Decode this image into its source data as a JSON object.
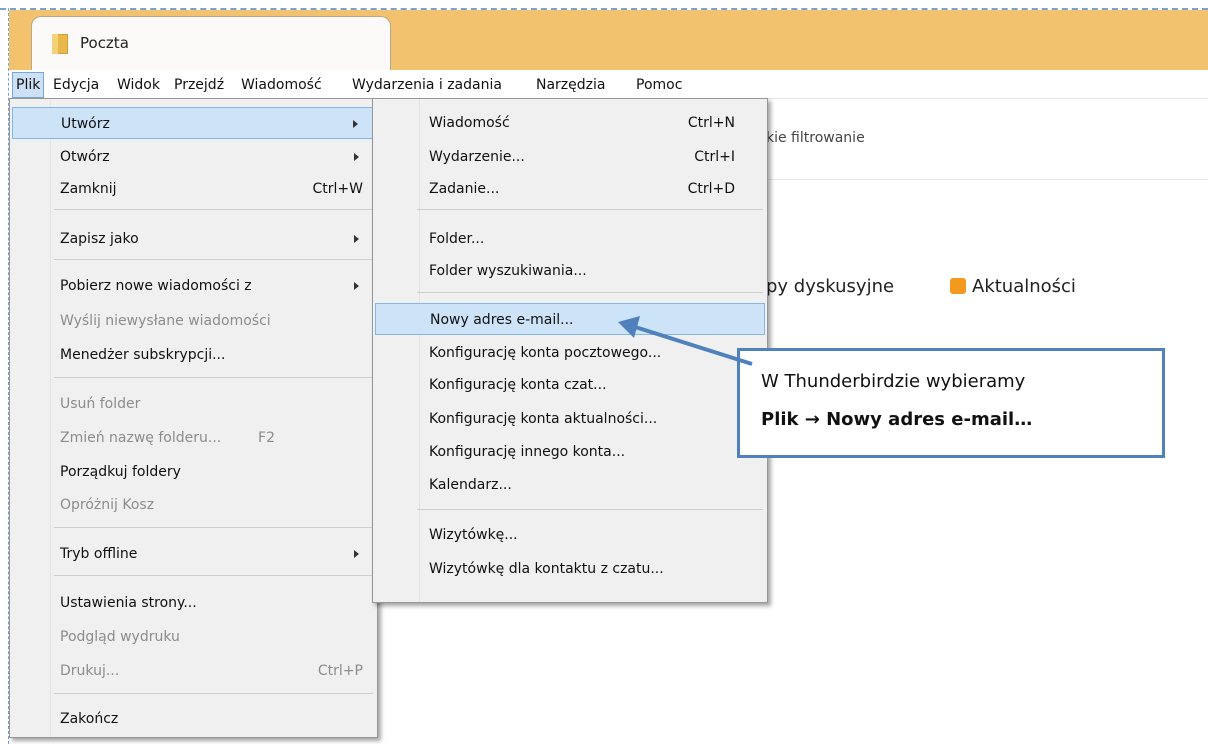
{
  "tab": {
    "label": "Poczta"
  },
  "menubar": {
    "items": [
      "Plik",
      "Edycja",
      "Widok",
      "Przejdź",
      "Wiadomość",
      "Wydarzenia i zadania",
      "Narzędzia",
      "Pomoc"
    ]
  },
  "background": {
    "filter_text": "kie filtrowanie",
    "groups_text": "py dyskusyjne",
    "feeds_text": "Aktualności"
  },
  "file_menu": {
    "items": [
      {
        "label": "Utwórz",
        "shortcut": ""
      },
      {
        "label": "Otwórz",
        "shortcut": ""
      },
      {
        "label": "Zamknij",
        "shortcut": "Ctrl+W"
      },
      {
        "label": "Zapisz jako",
        "shortcut": ""
      },
      {
        "label": "Pobierz nowe wiadomości z",
        "shortcut": ""
      },
      {
        "label": "Wyślij niewysłane wiadomości",
        "shortcut": ""
      },
      {
        "label": "Menedżer subskrypcji...",
        "shortcut": ""
      },
      {
        "label": "Usuń folder",
        "shortcut": ""
      },
      {
        "label": "Zmień nazwę folderu...",
        "shortcut": "F2"
      },
      {
        "label": "Porządkuj foldery",
        "shortcut": ""
      },
      {
        "label": "Opróżnij Kosz",
        "shortcut": ""
      },
      {
        "label": "Tryb offline",
        "shortcut": ""
      },
      {
        "label": "Ustawienia strony...",
        "shortcut": ""
      },
      {
        "label": "Podgląd wydruku",
        "shortcut": ""
      },
      {
        "label": "Drukuj...",
        "shortcut": "Ctrl+P"
      },
      {
        "label": "Zakończ",
        "shortcut": ""
      }
    ]
  },
  "create_menu": {
    "items": [
      {
        "label": "Wiadomość",
        "shortcut": "Ctrl+N"
      },
      {
        "label": "Wydarzenie...",
        "shortcut": "Ctrl+I"
      },
      {
        "label": "Zadanie...",
        "shortcut": "Ctrl+D"
      },
      {
        "label": "Folder...",
        "shortcut": ""
      },
      {
        "label": "Folder wyszukiwania...",
        "shortcut": ""
      },
      {
        "label": "Nowy adres e-mail...",
        "shortcut": ""
      },
      {
        "label": "Konfigurację konta pocztowego...",
        "shortcut": ""
      },
      {
        "label": "Konfigurację konta czat...",
        "shortcut": ""
      },
      {
        "label": "Konfigurację konta aktualności...",
        "shortcut": ""
      },
      {
        "label": "Konfigurację innego konta...",
        "shortcut": ""
      },
      {
        "label": "Kalendarz...",
        "shortcut": ""
      },
      {
        "label": "Wizytówkę...",
        "shortcut": ""
      },
      {
        "label": "Wizytówkę dla kontaktu z czatu...",
        "shortcut": ""
      }
    ]
  },
  "callout": {
    "line1": "W Thunderbirdzie wybieramy",
    "line2": "Plik → Nowy adres e-mail…"
  },
  "colors": {
    "tabbar": "#f2c26f",
    "highlight": "#cde3f8",
    "callout_border": "#4f81bd"
  }
}
